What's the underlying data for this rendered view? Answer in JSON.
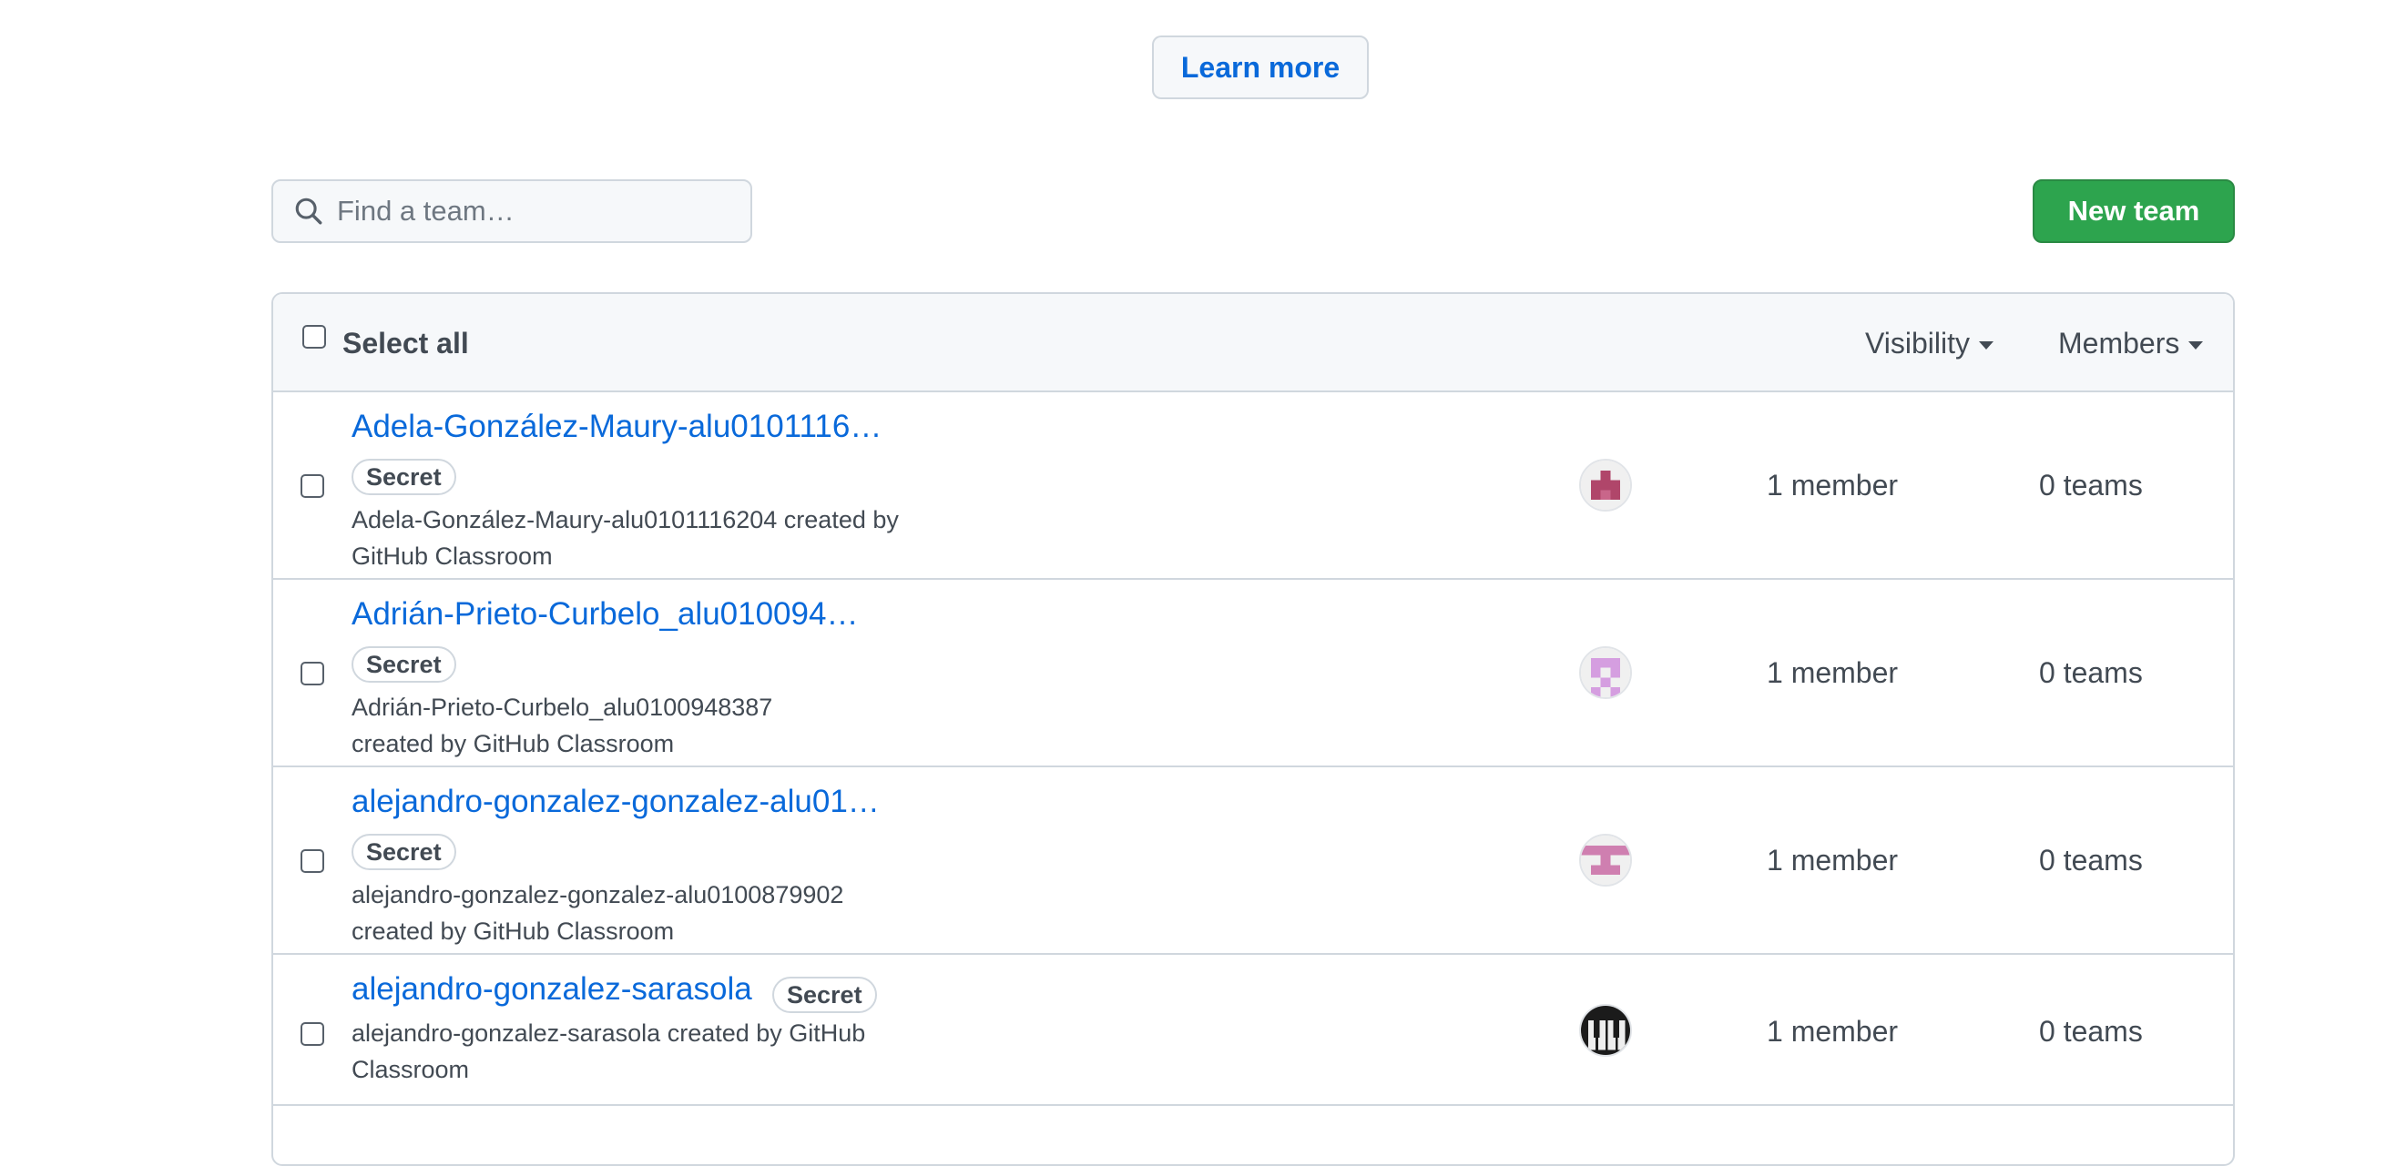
{
  "learn_more": "Learn more",
  "search": {
    "placeholder": "Find a team…"
  },
  "new_team": "New team",
  "list_header": {
    "select_all": "Select all",
    "visibility": "Visibility",
    "members": "Members"
  },
  "teams": [
    {
      "name": "Adela-González-Maury-alu0101116…",
      "badge": "Secret",
      "description": "Adela-González-Maury-alu0101116204 created by GitHub Classroom",
      "avatar_icon": "identicon-magenta-icon",
      "members": "1 member",
      "teams": "0 teams"
    },
    {
      "name": "Adrián-Prieto-Curbelo_alu010094…",
      "badge": "Secret",
      "description": "Adrián-Prieto-Curbelo_alu0100948387 created by GitHub Classroom",
      "avatar_icon": "identicon-lilac-icon",
      "members": "1 member",
      "teams": "0 teams"
    },
    {
      "name": "alejandro-gonzalez-gonzalez-alu01…",
      "badge": "Secret",
      "description": "alejandro-gonzalez-gonzalez-alu0100879902 created by GitHub Classroom",
      "avatar_icon": "identicon-pink-icon",
      "members": "1 member",
      "teams": "0 teams"
    },
    {
      "name": "alejandro-gonzalez-sarasola",
      "badge": "Secret",
      "description": "alejandro-gonzalez-sarasola created by GitHub Classroom",
      "avatar_icon": "piano-keys-avatar-icon",
      "members": "1 member",
      "teams": "0 teams"
    }
  ]
}
